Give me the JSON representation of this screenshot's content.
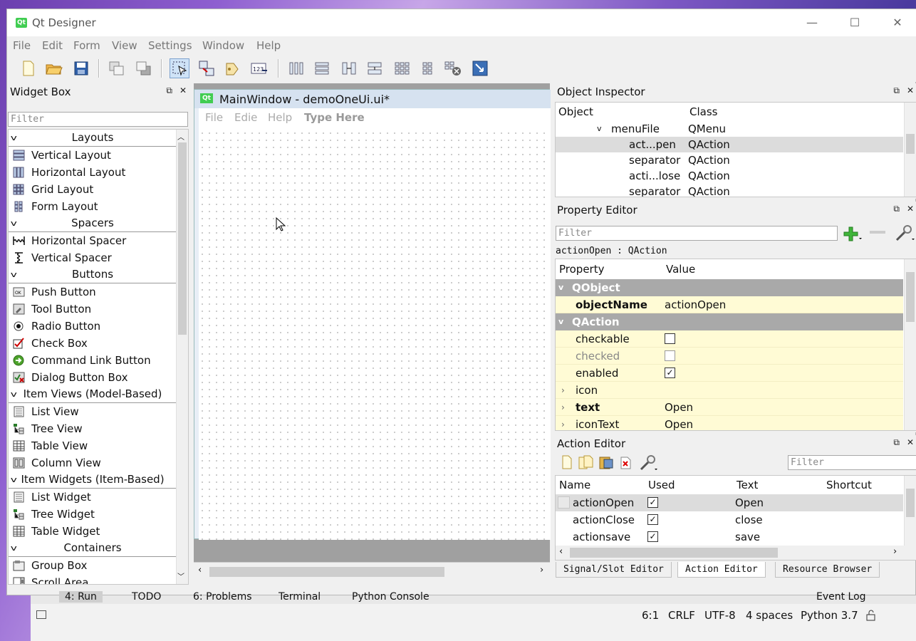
{
  "window": {
    "title": "Qt Designer",
    "controls": [
      "—",
      "☐",
      "✕"
    ]
  },
  "menu": [
    "File",
    "Edit",
    "Form",
    "View",
    "Settings",
    "Window",
    "Help"
  ],
  "widget_box": {
    "title": "Widget Box",
    "filter_placeholder": "Filter",
    "sections": [
      {
        "label": "Layouts",
        "items": [
          "Vertical Layout",
          "Horizontal Layout",
          "Grid Layout",
          "Form Layout"
        ]
      },
      {
        "label": "Spacers",
        "items": [
          "Horizontal Spacer",
          "Vertical Spacer"
        ]
      },
      {
        "label": "Buttons",
        "items": [
          "Push Button",
          "Tool Button",
          "Radio Button",
          "Check Box",
          "Command Link Button",
          "Dialog Button Box"
        ]
      },
      {
        "label": "Item Views (Model-Based)",
        "items": [
          "List View",
          "Tree View",
          "Table View",
          "Column View"
        ]
      },
      {
        "label": "Item Widgets (Item-Based)",
        "items": [
          "List Widget",
          "Tree Widget",
          "Table Widget"
        ]
      },
      {
        "label": "Containers",
        "items": [
          "Group Box",
          "Scroll Area"
        ]
      }
    ]
  },
  "form": {
    "title": "MainWindow - demoOneUi.ui*",
    "menu": [
      "File",
      "Edie",
      "Help"
    ],
    "type_here": "Type Here"
  },
  "object_inspector": {
    "title": "Object Inspector",
    "col_object": "Object",
    "col_class": "Class",
    "rows": [
      {
        "obj": "menuFile",
        "cls": "QMenu"
      },
      {
        "obj": "act...pen",
        "cls": "QAction"
      },
      {
        "obj": "separator",
        "cls": "QAction"
      },
      {
        "obj": "acti...lose",
        "cls": "QAction"
      },
      {
        "obj": "separator",
        "cls": "QAction"
      }
    ]
  },
  "property_editor": {
    "title": "Property Editor",
    "filter_placeholder": "Filter",
    "context": "actionOpen : QAction",
    "col_property": "Property",
    "col_value": "Value",
    "group1": "QObject",
    "objectName_label": "objectName",
    "objectName_value": "actionOpen",
    "group2": "QAction",
    "checkable_label": "checkable",
    "checked_label": "checked",
    "enabled_label": "enabled",
    "icon_label": "icon",
    "text_label": "text",
    "text_value": "Open",
    "iconText_label": "iconText",
    "iconText_value": "Open"
  },
  "action_editor": {
    "title": "Action Editor",
    "filter_placeholder": "Filter",
    "columns": [
      "Name",
      "Used",
      "Text",
      "Shortcut"
    ],
    "rows": [
      {
        "name": "actionOpen",
        "text": "Open"
      },
      {
        "name": "actionClose",
        "text": "close"
      },
      {
        "name": "actionsave",
        "text": "save"
      }
    ]
  },
  "bottom_tabs": [
    "Signal/Slot Editor",
    "Action Editor",
    "Resource Browser"
  ],
  "ide": {
    "tools": [
      "4: Run",
      "TODO",
      "6: Problems",
      "Terminal",
      "Python Console",
      "Event Log"
    ],
    "status": [
      "6:1",
      "CRLF",
      "UTF-8",
      "4 spaces",
      "Python 3.7"
    ]
  }
}
